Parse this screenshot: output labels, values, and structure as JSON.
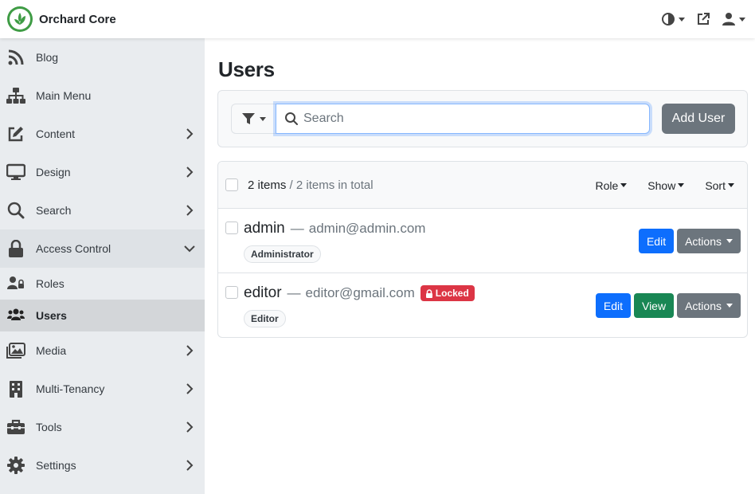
{
  "brand": {
    "name": "Orchard Core"
  },
  "topbar": {
    "icons": [
      "theme-toggle-icon",
      "external-link-icon",
      "user-icon"
    ]
  },
  "sidebar": {
    "items": [
      {
        "label": "Blog",
        "icon": "rss-icon"
      },
      {
        "label": "Main Menu",
        "icon": "sitemap-icon"
      },
      {
        "label": "Content",
        "icon": "edit-icon"
      },
      {
        "label": "Design",
        "icon": "desktop-icon"
      },
      {
        "label": "Search",
        "icon": "search-icon"
      },
      {
        "label": "Access Control",
        "icon": "lock-icon"
      },
      {
        "label": "Roles",
        "icon": "user-lock-icon"
      },
      {
        "label": "Users",
        "icon": "users-icon"
      },
      {
        "label": "Media",
        "icon": "images-icon"
      },
      {
        "label": "Multi-Tenancy",
        "icon": "building-icon"
      },
      {
        "label": "Tools",
        "icon": "toolbox-icon"
      },
      {
        "label": "Settings",
        "icon": "cog-icon"
      }
    ]
  },
  "main": {
    "title": "Users",
    "search": {
      "placeholder": "Search",
      "add_user_label": "Add User"
    },
    "list": {
      "count_label": "2 items",
      "total_label": "/ 2 items in total",
      "menus": {
        "role": "Role",
        "show": "Show",
        "sort": "Sort"
      },
      "users": [
        {
          "name": "admin",
          "email": "admin@admin.com",
          "role": "Administrator",
          "locked": false
        },
        {
          "name": "editor",
          "email": "editor@gmail.com",
          "role": "Editor",
          "locked": true,
          "locked_label": "Locked"
        }
      ],
      "buttons": {
        "edit": "Edit",
        "view": "View",
        "actions": "Actions"
      },
      "dash": "—"
    }
  },
  "colors": {
    "accent": "#0d6efd",
    "success": "#198754",
    "danger": "#dc3545",
    "secondary": "#6c757d",
    "brand": "#3f9c45"
  }
}
